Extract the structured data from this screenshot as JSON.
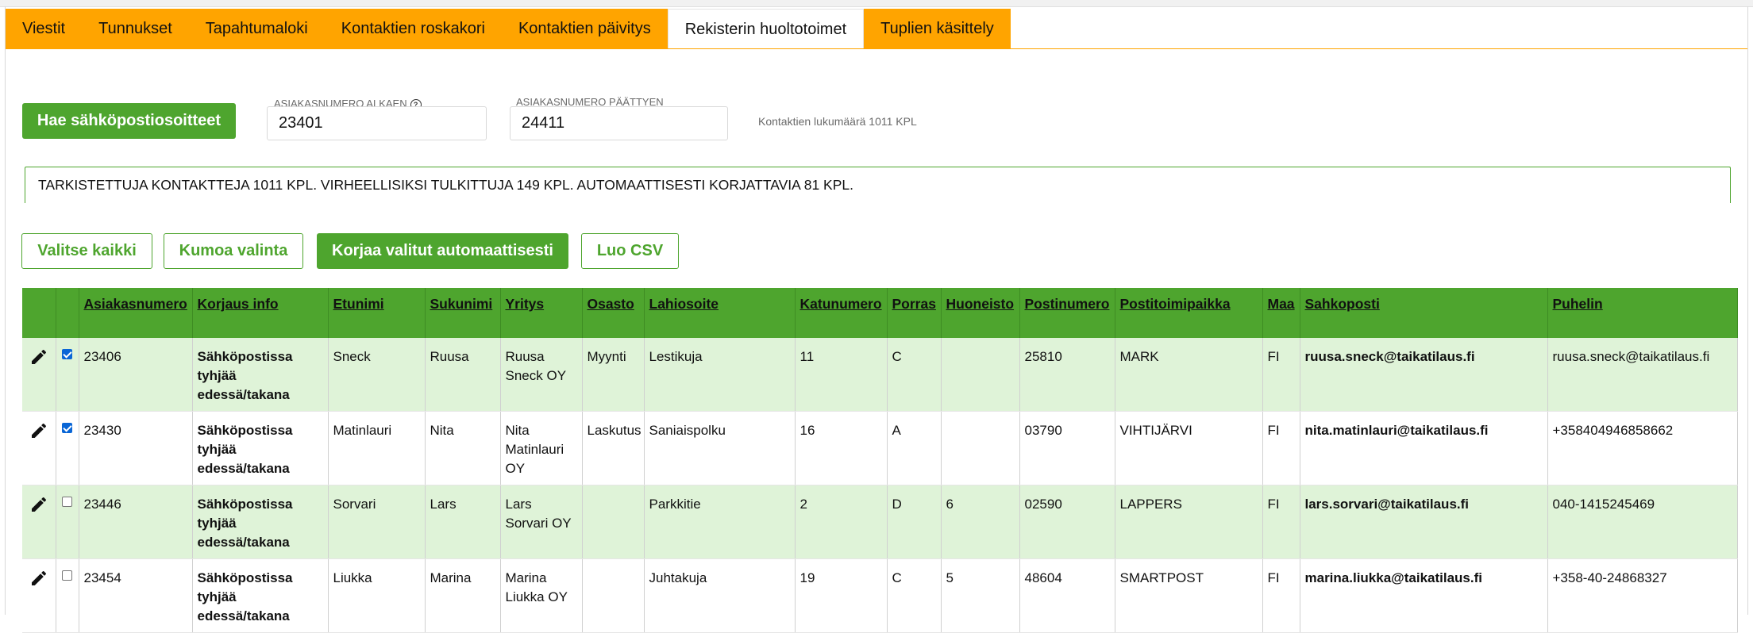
{
  "tabs": [
    {
      "label": "Viestit",
      "active": false
    },
    {
      "label": "Tunnukset",
      "active": false
    },
    {
      "label": "Tapahtumaloki",
      "active": false
    },
    {
      "label": "Kontaktien roskakori",
      "active": false
    },
    {
      "label": "Kontaktien päivitys",
      "active": false
    },
    {
      "label": "Rekisterin huoltotoimet",
      "active": true
    },
    {
      "label": "Tuplien käsittely",
      "active": false
    }
  ],
  "controls": {
    "fetch_button": "Hae sähköpostiosoitteet",
    "start_label": "Asiakasnumero alkaen",
    "start_value": "23401",
    "end_label": "Asiakasnumero päättyen",
    "end_value": "24411",
    "count_label": "Kontaktien lukumäärä 1011 KPL"
  },
  "summary": "TARKISTETTUJA KONTAKTTEJA 1011 KPL. VIRHEELLISIKSI TULKITTUJA 149 KPL. AUTOMAATTISESTI KORJATTAVIA 81 KPL.",
  "actions": {
    "select_all": "Valitse kaikki",
    "undo_selection": "Kumoa valinta",
    "fix_auto": "Korjaa valitut automaattisesti",
    "create_csv": "Luo CSV"
  },
  "colors": {
    "tab": "#ffa400",
    "accent": "#4ea52e",
    "row_alt": "#dff3d8",
    "checkbox": "#0a66d6"
  },
  "table": {
    "headers": [
      "Asiakasnumero",
      "Korjaus info",
      "Etunimi",
      "Sukunimi",
      "Yritys",
      "Osasto",
      "Lahiosoite",
      "Katunumero",
      "Porras",
      "Huoneisto",
      "Postinumero",
      "Postitoimipaikka",
      "Maa",
      "Sahkoposti",
      "Puhelin"
    ],
    "rows": [
      {
        "checked": true,
        "cells": [
          "23406",
          "Sähköpostissa tyhjää edessä/takana",
          "Sneck",
          "Ruusa",
          "Ruusa Sneck OY",
          "Myynti",
          "Lestikuja",
          "11",
          "C",
          "",
          "25810",
          "MARK",
          "FI",
          "ruusa.sneck@taikatilaus.fi",
          "ruusa.sneck@taikatilaus.fi"
        ]
      },
      {
        "checked": true,
        "cells": [
          "23430",
          "Sähköpostissa tyhjää edessä/takana",
          "Matinlauri",
          "Nita",
          "Nita Matinlauri OY",
          "Laskutus",
          "Saniaispolku",
          "16",
          "A",
          "",
          "03790",
          "VIHTIJÄRVI",
          "FI",
          "nita.matinlauri@taikatilaus.fi",
          "+358404946858662"
        ]
      },
      {
        "checked": false,
        "cells": [
          "23446",
          "Sähköpostissa tyhjää edessä/takana",
          "Sorvari",
          "Lars",
          "Lars Sorvari OY",
          "",
          "Parkkitie",
          "2",
          "D",
          "6",
          "02590",
          "LAPPERS",
          "FI",
          "lars.sorvari@taikatilaus.fi",
          "040-1415245469"
        ]
      },
      {
        "checked": false,
        "cells": [
          "23454",
          "Sähköpostissa tyhjää edessä/takana",
          "Liukka",
          "Marina",
          "Marina Liukka OY",
          "",
          "Juhtakuja",
          "19",
          "C",
          "5",
          "48604",
          "SMARTPOST",
          "FI",
          "marina.liukka@taikatilaus.fi",
          "+358-40-24868327"
        ]
      }
    ]
  }
}
